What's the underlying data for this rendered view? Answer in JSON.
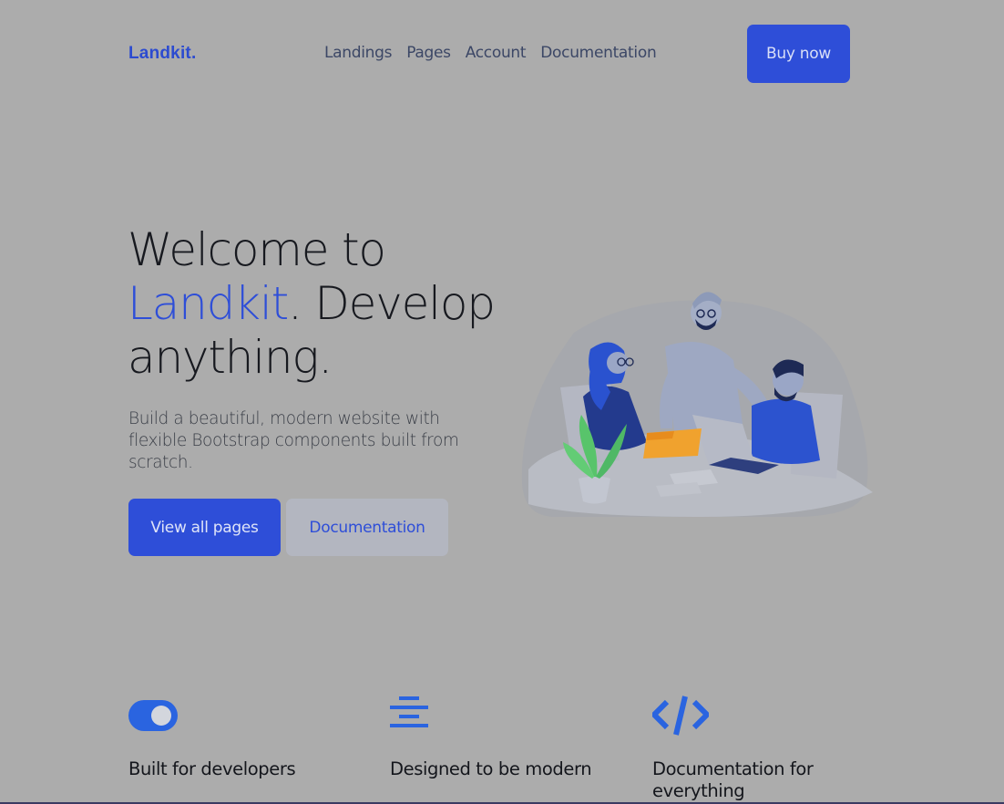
{
  "navbar": {
    "brand": "Landkit.",
    "links": [
      "Landings",
      "Pages",
      "Account",
      "Documentation"
    ],
    "cta": "Buy now"
  },
  "hero": {
    "title_line1": "Welcome to",
    "title_accent": "Landkit",
    "title_rest": ". Develop",
    "title_line3": "anything.",
    "subtitle": "Build a beautiful, modern website with flexible Bootstrap components built from scratch.",
    "primary_button": "View all pages",
    "secondary_button": "Documentation"
  },
  "features": [
    {
      "icon": "toggle-icon",
      "title": "Built for developers"
    },
    {
      "icon": "align-center-icon",
      "title": "Designed to be modern"
    },
    {
      "icon": "code-icon",
      "title": "Documentation for everything"
    }
  ],
  "colors": {
    "background": "#acacac",
    "brand": "#2e4ed8",
    "text": "#17191f"
  }
}
